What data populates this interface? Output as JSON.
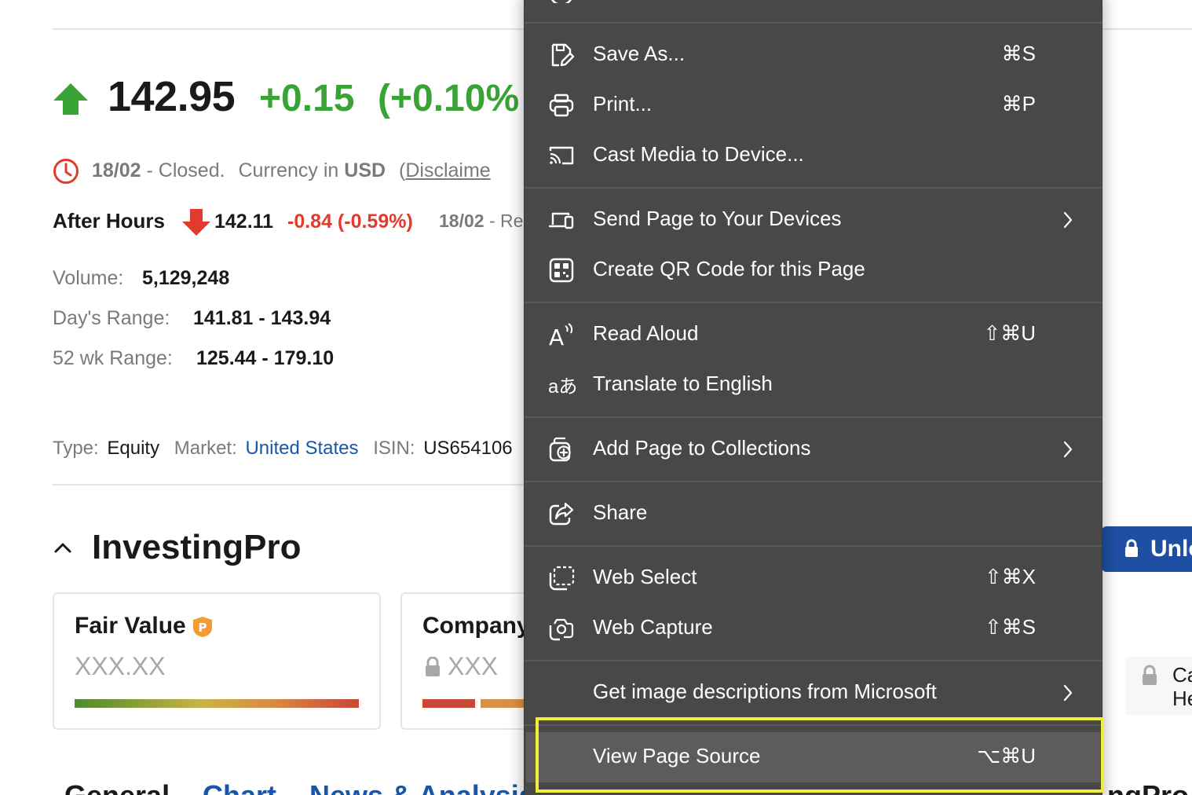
{
  "quote": {
    "price": "142.95",
    "change": "+0.15",
    "change_pct": "(+0.10%",
    "date": "18/02",
    "status_sep": " - ",
    "status": "Closed.",
    "currency_prefix": "Currency in",
    "currency": "USD",
    "disclaimer_open": "(",
    "disclaimer": "Disclaime",
    "after_hours_label": "After Hours",
    "after_price": "142.11",
    "after_change": "-0.84 (-0.59%)",
    "after_date": "18/02",
    "after_status": " - Re"
  },
  "stats": {
    "volume_label": "Volume:",
    "volume_value": "5,129,248",
    "days_range_label": "Day's Range:",
    "days_range_value": "141.81 - 143.94",
    "wk52_label": "52 wk Range:",
    "wk52_value": "125.44 - 179.10"
  },
  "meta": {
    "type_label": "Type:",
    "type_value": "Equity",
    "market_label": "Market:",
    "market_value": "United States",
    "isin_label": "ISIN:",
    "isin_value": "US654106"
  },
  "investingpro": {
    "title": "InvestingPro",
    "fair_value_title": "Fair Value",
    "fair_value_value": "XXX.XX",
    "company_title": "Company",
    "company_value": "XXX",
    "unlock_label": "Unlo",
    "side_box_line1": "Ca",
    "side_box_line2": "He",
    "pro_badge_letter": "P"
  },
  "bottom_tabs": {
    "general": "General",
    "chart": "Chart",
    "news": "News & Analysis",
    "pro": "ngPro"
  },
  "menu": {
    "items": [
      {
        "label": "Save As...",
        "shortcut": "⌘S",
        "icon": "save-as-icon"
      },
      {
        "label": "Print...",
        "shortcut": "⌘P",
        "icon": "print-icon"
      },
      {
        "label": "Cast Media to Device...",
        "shortcut": "",
        "icon": "cast-icon"
      },
      {
        "label": "Send Page to Your Devices",
        "shortcut": "",
        "icon": "devices-icon",
        "submenu": true
      },
      {
        "label": "Create QR Code for this Page",
        "shortcut": "",
        "icon": "qr-code-icon"
      },
      {
        "label": "Read Aloud",
        "shortcut": "⇧⌘U",
        "icon": "read-aloud-icon"
      },
      {
        "label": "Translate to English",
        "shortcut": "",
        "icon": "translate-icon"
      },
      {
        "label": "Add Page to Collections",
        "shortcut": "",
        "icon": "collections-icon",
        "submenu": true
      },
      {
        "label": "Share",
        "shortcut": "",
        "icon": "share-icon"
      },
      {
        "label": "Web Select",
        "shortcut": "⇧⌘X",
        "icon": "web-select-icon"
      },
      {
        "label": "Web Capture",
        "shortcut": "⇧⌘S",
        "icon": "web-capture-icon"
      },
      {
        "label": "Get image descriptions from Microsoft",
        "shortcut": "",
        "icon": "",
        "submenu": true
      },
      {
        "label": "View Page Source",
        "shortcut": "⌥⌘U",
        "icon": "",
        "highlighted": true
      }
    ],
    "translate_glyph": "aあ",
    "read_aloud_glyph": "A"
  },
  "colors": {
    "positive": "#3aa335",
    "negative": "#e23b2e",
    "link": "#1a56a8",
    "menu_bg": "#484848",
    "menu_highlight": "#5c5c5c",
    "annotation_frame": "#f2ec3a",
    "unlock_button": "#1f4fa3"
  }
}
